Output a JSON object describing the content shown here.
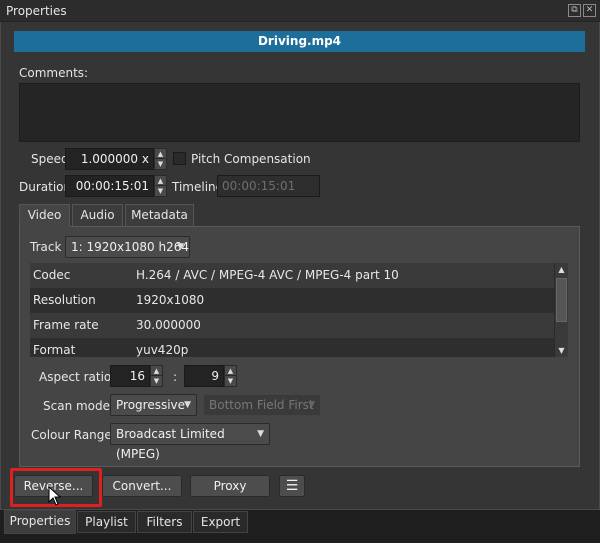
{
  "window": {
    "title": "Properties"
  },
  "file": {
    "name": "Driving.mp4"
  },
  "comments": {
    "label": "Comments:",
    "value": ""
  },
  "speed": {
    "label": "Speed",
    "value": "1.000000 x"
  },
  "pitch": {
    "label": "Pitch Compensation",
    "checked": false
  },
  "duration": {
    "label": "Duration",
    "value": "00:00:15:01"
  },
  "timeline": {
    "label": "Timeline",
    "value": "00:00:15:01"
  },
  "tabs": [
    {
      "label": "Video",
      "active": true
    },
    {
      "label": "Audio",
      "active": false
    },
    {
      "label": "Metadata",
      "active": false
    }
  ],
  "track": {
    "label": "Track",
    "value": "1: 1920x1080 h264"
  },
  "info_rows": [
    {
      "key": "Codec",
      "value": "H.264 / AVC / MPEG-4 AVC / MPEG-4 part 10"
    },
    {
      "key": "Resolution",
      "value": "1920x1080"
    },
    {
      "key": "Frame rate",
      "value": "30.000000"
    },
    {
      "key": "Format",
      "value": "yuv420p"
    }
  ],
  "aspect": {
    "label": "Aspect ratio",
    "num": "16",
    "sep": ":",
    "den": "9"
  },
  "scan": {
    "label": "Scan mode",
    "value": "Progressive",
    "field_value": "Bottom Field First"
  },
  "colour": {
    "label": "Colour Range",
    "value": "Broadcast Limited (MPEG)"
  },
  "buttons": {
    "reverse": "Reverse...",
    "convert": "Convert...",
    "proxy": "Proxy",
    "menu": "☰"
  },
  "bottom_tabs": [
    {
      "label": "Properties",
      "active": true
    },
    {
      "label": "Playlist",
      "active": false
    },
    {
      "label": "Filters",
      "active": false
    },
    {
      "label": "Export",
      "active": false
    }
  ],
  "colors": {
    "accent": "#1d6e9b",
    "highlight": "#e02020"
  }
}
